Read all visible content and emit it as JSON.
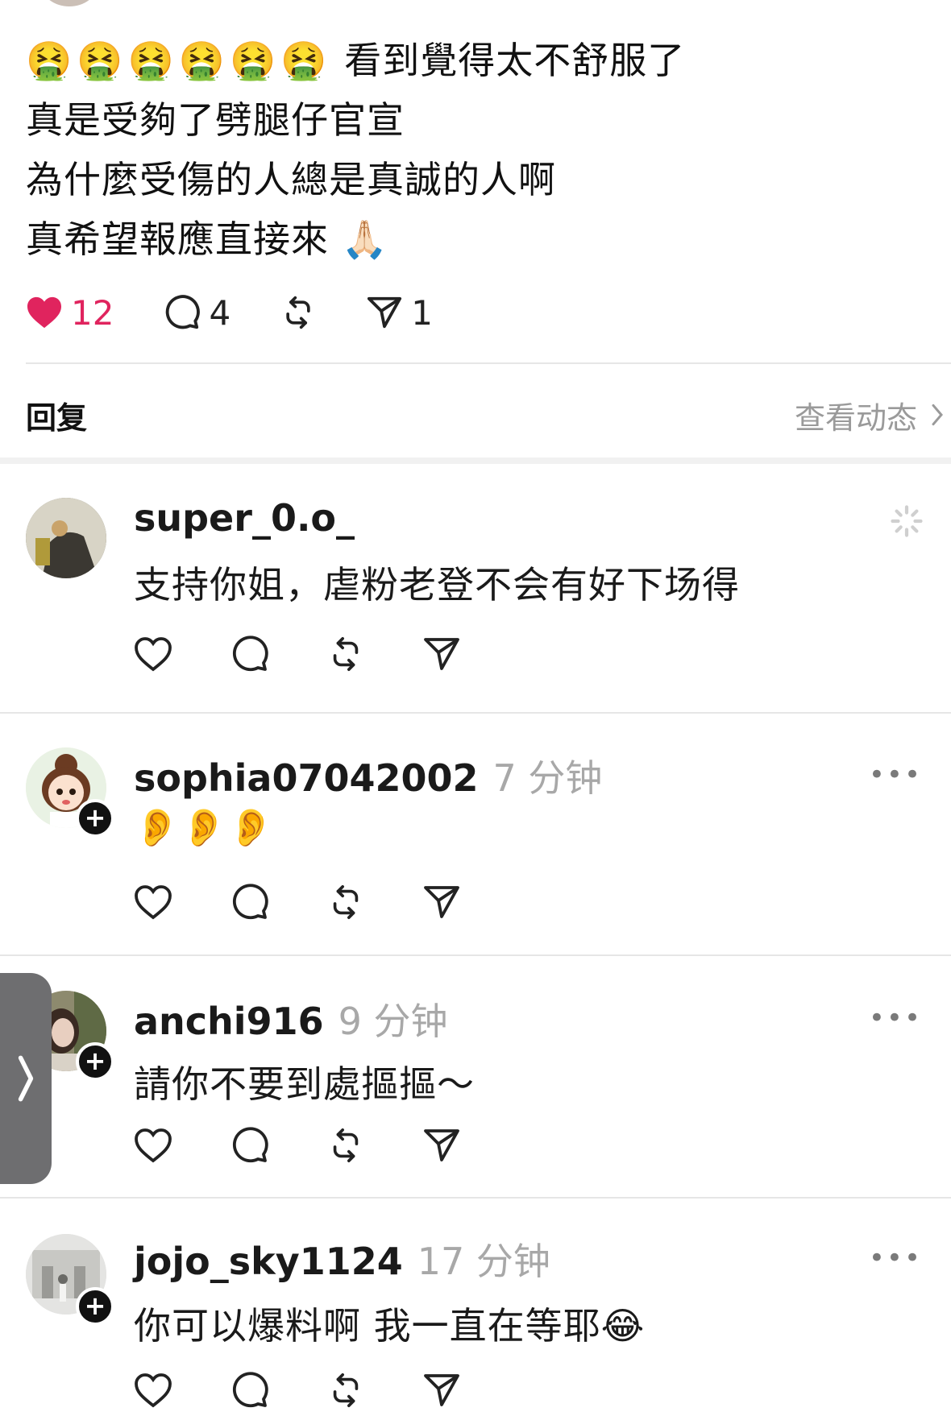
{
  "post": {
    "emoji": "🤮🤮🤮🤮🤮🤮",
    "line1": "看到覺得太不舒服了",
    "line2": "真是受夠了劈腿仔官宣",
    "line3": "為什麼受傷的人總是真誠的人啊",
    "line4": "真希望報應直接來",
    "line4_emoji": "🙏🏻",
    "likes": "12",
    "comments": "4",
    "shares": "1"
  },
  "reply_bar": {
    "label": "回复",
    "view_activity": "查看动态"
  },
  "comments": [
    {
      "username": "super_0.o_",
      "time": "",
      "text": "支持你姐，虐粉老登不会有好下场得"
    },
    {
      "username": "sophia07042002",
      "time": "7 分钟",
      "text": "👂👂👂"
    },
    {
      "username": "anchi916",
      "time": "9 分钟",
      "text": "請你不要到處摳摳～"
    },
    {
      "username": "jojo_sky1124",
      "time": "17 分钟",
      "text": "你可以爆料啊 我一直在等耶😂"
    }
  ],
  "more_label": "•••",
  "colors": {
    "like": "#e0245e",
    "muted": "#a8a8a8",
    "handle": "#6e6e70"
  }
}
